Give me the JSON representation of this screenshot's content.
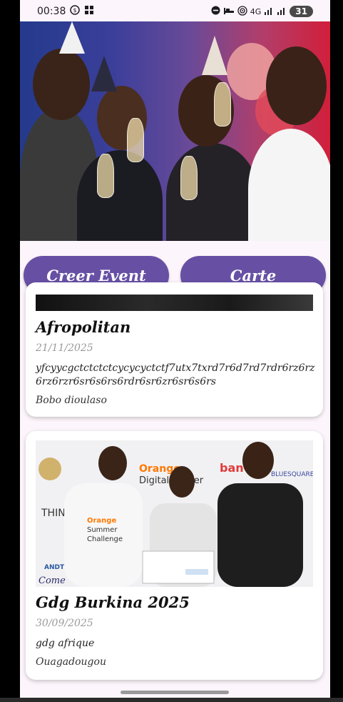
{
  "status_bar": {
    "time": "00:38",
    "battery": "31",
    "network": "4G"
  },
  "actions": {
    "create_event_label": "Creer Event",
    "map_label": "Carte"
  },
  "events": [
    {
      "title": "Afropolitan",
      "date": "21/11/2025",
      "description": "yfcyycgctctctctcycycyctctf7utx7txrd7r6d7rd7rdr6rz6rz6rz6rzr6sr6s6rs6rdr6sr6zr6sr6s6rs",
      "location": "Bobo dioulaso"
    },
    {
      "title": "Gdg Burkina 2025",
      "date": "30/09/2025",
      "description": "gdg afrique",
      "location": "Ouagadougou"
    }
  ],
  "image_text": {
    "orange": "Orange",
    "digital_center": "Digital Center",
    "summer_challenge": "Orange Summer Challenge",
    "bluesquare": "BLUESQUARE",
    "think": "THIN",
    "andtic": "ANDTIC",
    "come": "Come"
  }
}
